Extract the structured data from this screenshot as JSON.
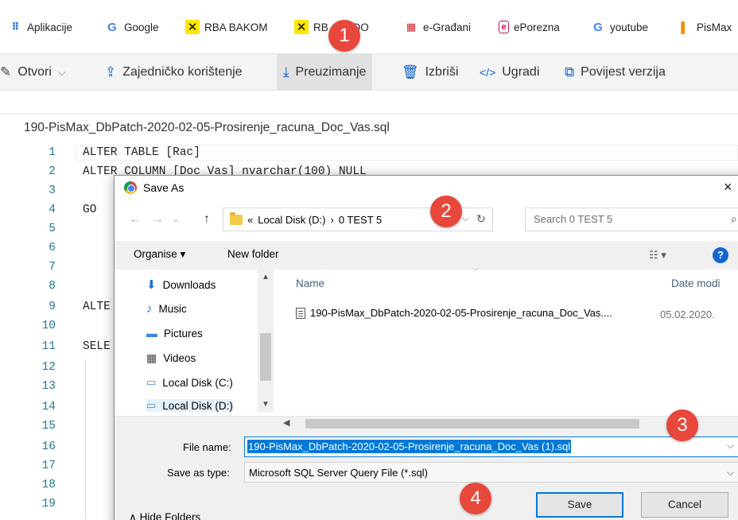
{
  "bookmarks": [
    {
      "label": "Aplikacije",
      "icon": "apps-grid-icon"
    },
    {
      "label": "Google",
      "icon": "google-g-icon"
    },
    {
      "label": "RBA BAKOM",
      "icon": "raiffeisen-icon"
    },
    {
      "label": "RB      ADO",
      "icon": "raiffeisen-icon"
    },
    {
      "label": "e-Građani",
      "icon": "egradjani-icon"
    },
    {
      "label": "ePorezna",
      "icon": "eporezna-icon"
    },
    {
      "label": "youtube",
      "icon": "google-g-icon"
    },
    {
      "label": "PisMax",
      "icon": "pismax-icon"
    }
  ],
  "toolbar": {
    "open": "Otvori",
    "share": "Zajedničko korištenje",
    "download": "Preuzimanje",
    "delete": "Izbriši",
    "embed": "Ugradi",
    "history": "Povijest verzija"
  },
  "editor": {
    "filename": "190-PisMax_DbPatch-2020-02-05-Prosirenje_racuna_Doc_Vas.sql",
    "line_numbers": [
      "1",
      "2",
      "3",
      "4",
      "5",
      "6",
      "7",
      "8",
      "9",
      "10",
      "11",
      "12",
      "13",
      "14",
      "15",
      "16",
      "17",
      "18",
      "19"
    ],
    "code": {
      "l1": "ALTER TABLE [Rac]",
      "l2": "ALTER COLUMN [Doc_Vas] nvarchar(100) NULL",
      "l4": "GO",
      "l9": "ALTE",
      "l11": "SELE"
    }
  },
  "dialog": {
    "title": "Save As",
    "close": "×",
    "nav": {
      "back": "←",
      "forward": "→",
      "recent": "⌄",
      "up": "↑"
    },
    "path": {
      "prefix": "«",
      "drive": "Local Disk (D:)",
      "sep": "›",
      "folder": "0 TEST 5"
    },
    "search_placeholder": "Search 0 TEST 5",
    "commands": {
      "organise": "Organise ▾",
      "new_folder": "New folder"
    },
    "nav_pane": [
      "Downloads",
      "Music",
      "Pictures",
      "Videos",
      "Local Disk (C:)",
      "Local Disk (D:)"
    ],
    "columns": {
      "name": "Name",
      "date": "Date modi"
    },
    "files": [
      {
        "name": "190-PisMax_DbPatch-2020-02-05-Prosirenje_racuna_Doc_Vas....",
        "date": "05.02.2020."
      }
    ],
    "file_name_label": "File name:",
    "file_name_value": "190-PisMax_DbPatch-2020-02-05-Prosirenje_racuna_Doc_Vas (1).sql",
    "save_type_label": "Save as type:",
    "save_type_value": "Microsoft SQL Server Query File (*.sql)",
    "hide_folders": "Hide Folders",
    "save_button": "Save",
    "cancel_button": "Cancel"
  },
  "callouts": [
    "1",
    "2",
    "3",
    "4"
  ],
  "colors": {
    "accent": "#0078d7",
    "badge": "#e8473b",
    "line_number": "#237893"
  }
}
